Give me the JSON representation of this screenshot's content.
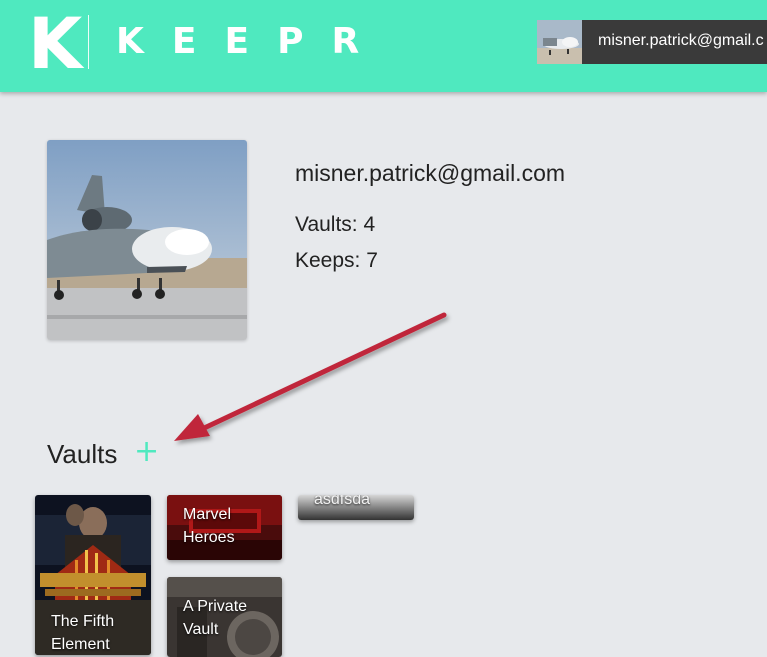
{
  "header": {
    "logo_letter": "K",
    "logo_text": "KEEPR",
    "user_email": "misner.patrick@gmail.c",
    "brand_color": "#4fe9bf"
  },
  "profile": {
    "email": "misner.patrick@gmail.com",
    "vaults_count": "Vaults: 4",
    "keeps_count": "Keeps: 7"
  },
  "vaults_section": {
    "heading": "Vaults",
    "add_icon": "+",
    "cards": [
      {
        "title": "The Fifth Element"
      },
      {
        "title": "Marvel Heroes"
      },
      {
        "title": "A Private Vault"
      },
      {
        "title": "asdfsda"
      }
    ]
  },
  "annotation": {
    "arrow_color": "#c0283a"
  }
}
